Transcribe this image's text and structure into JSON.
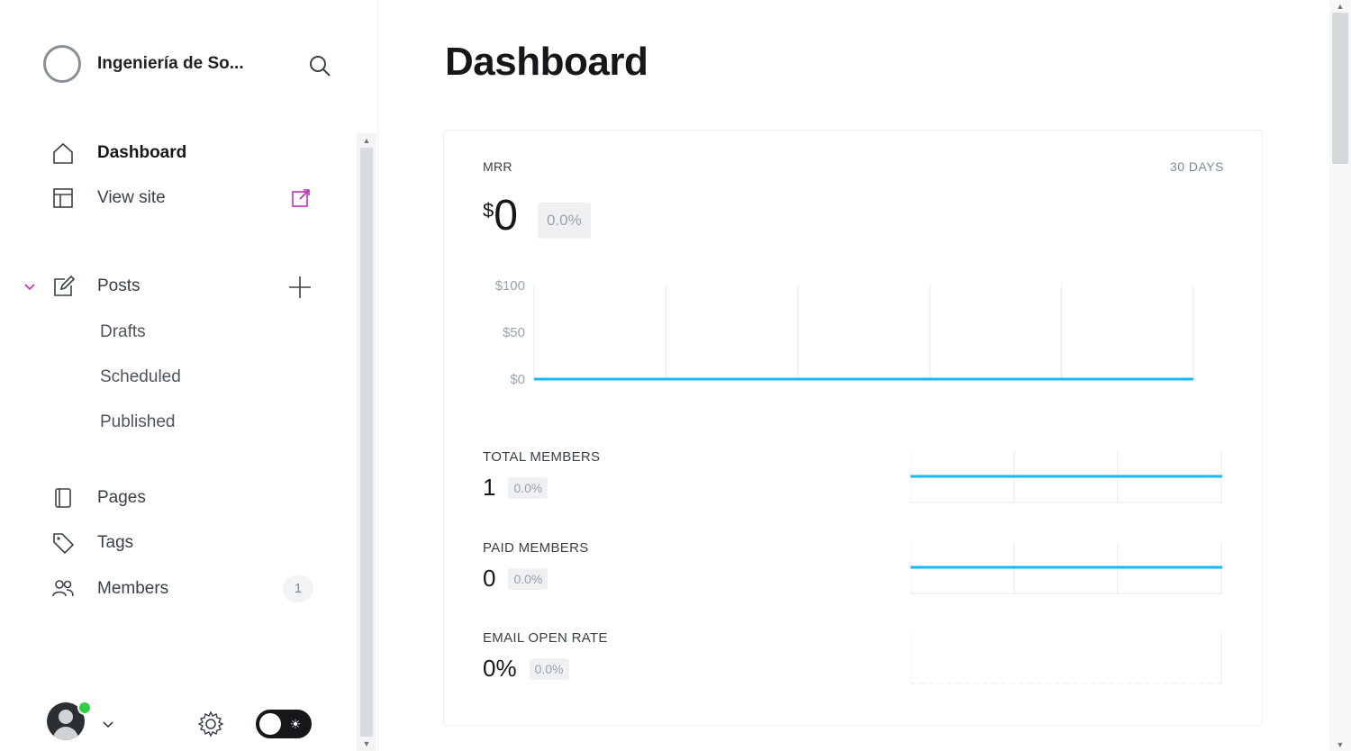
{
  "app": {
    "site_name": "Ingeniería de So...",
    "page_title": "Dashboard",
    "accent_color": "#14b8ff",
    "brand_color": "#c02fb7"
  },
  "sidebar": {
    "nav_top": [
      {
        "label": "Dashboard",
        "icon": "home-icon",
        "active": true
      },
      {
        "label": "View site",
        "icon": "layout-icon"
      }
    ],
    "posts": {
      "label": "Posts",
      "icon": "edit-icon",
      "subitems": [
        "Drafts",
        "Scheduled",
        "Published"
      ]
    },
    "nav_bottom": [
      {
        "label": "Pages",
        "icon": "page-icon"
      },
      {
        "label": "Tags",
        "icon": "tag-icon"
      },
      {
        "label": "Members",
        "icon": "members-icon",
        "badge": "1"
      }
    ]
  },
  "dashboard": {
    "mrr": {
      "label": "MRR",
      "range": "30 DAYS",
      "currency": "$",
      "value": "0",
      "change": "0.0%"
    },
    "metrics": [
      {
        "label": "TOTAL MEMBERS",
        "value": "1",
        "change": "0.0%"
      },
      {
        "label": "PAID MEMBERS",
        "value": "0",
        "change": "0.0%"
      },
      {
        "label": "EMAIL OPEN RATE",
        "value": "0%",
        "change": "0.0%"
      }
    ]
  },
  "chart_data": {
    "type": "line",
    "title": "",
    "y_ticks": [
      "$100",
      "$50",
      "$0"
    ],
    "ylim": [
      0,
      100
    ],
    "series": [
      {
        "values": [
          0,
          0,
          0,
          0,
          0,
          0
        ]
      }
    ],
    "grid": true
  }
}
